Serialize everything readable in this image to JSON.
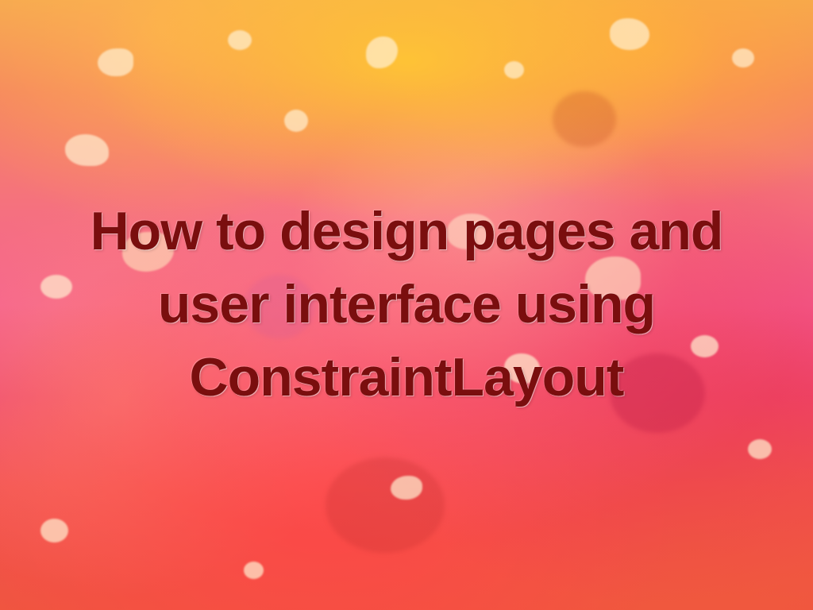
{
  "title": "How to design pages and user interface using ConstraintLayout",
  "colors": {
    "text": "#7a0e0e",
    "bg_top": "#f5a850",
    "bg_bottom": "#f05540"
  }
}
